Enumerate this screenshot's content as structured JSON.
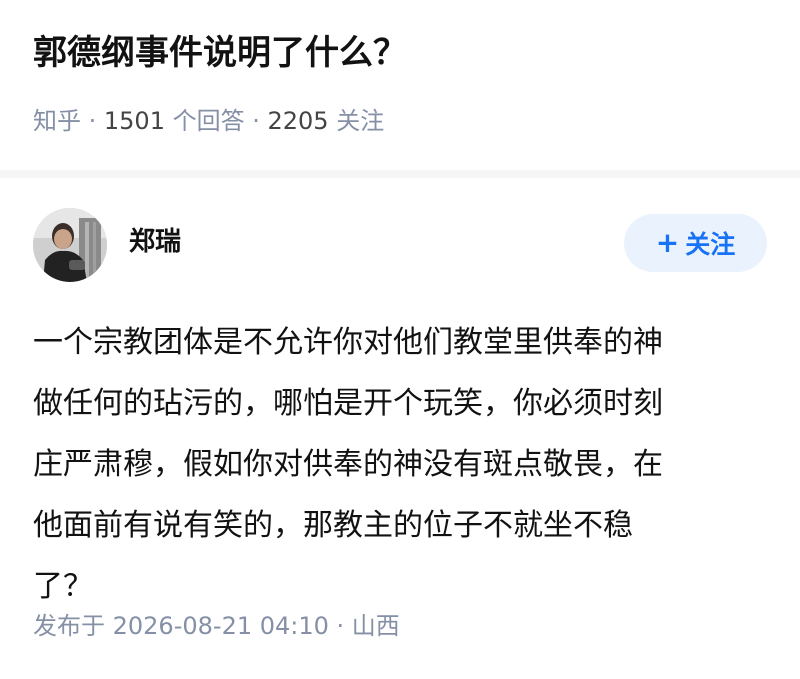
{
  "question": {
    "title": "郭德纲事件说明了什么？",
    "source": "知乎",
    "sep1": " · ",
    "answer_count": "1501",
    "answer_unit": " 个回答",
    "sep2": " · ",
    "follower_count": "2205",
    "follower_unit": " 关注"
  },
  "answer": {
    "author": {
      "name": "郑瑞",
      "avatar_icon": "user-photo-avatar"
    },
    "follow_button": {
      "icon": "plus-icon",
      "plus": "+",
      "label": "关注"
    },
    "content_lines": [
      "一个宗教团体是不允许你对他们教堂里供奉的神",
      "做任何的玷污的，哪怕是开个玩笑，你必须时刻",
      "庄严肃穆，假如你对供奉的神没有斑点敬畏，在",
      "他面前有说有笑的，那教主的位子不就坐不稳",
      "了？"
    ],
    "footer": {
      "published": "发布于 2026-08-21 04:10",
      "sep": " · ",
      "location": "山西"
    }
  },
  "colors": {
    "accent": "#1772f6",
    "accent_bg": "#eaf2fd",
    "meta_gray": "#8590a6",
    "divider": "#f6f6f6"
  }
}
